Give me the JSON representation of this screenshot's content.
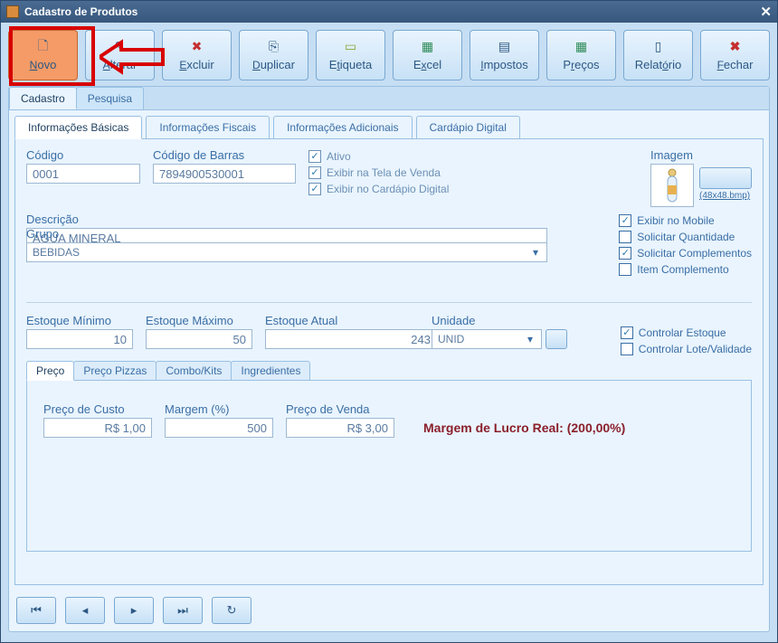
{
  "title": "Cadastro de Produtos",
  "toolbar": {
    "novo": "Novo",
    "alterar": "Alterar",
    "excluir": "Excluir",
    "duplicar": "Duplicar",
    "etiqueta": "Etiqueta",
    "excel": "Excel",
    "impostos": "Impostos",
    "precos": "Preços",
    "relatorio": "Relatório",
    "fechar": "Fechar"
  },
  "outerTabs": {
    "cadastro": "Cadastro",
    "pesquisa": "Pesquisa"
  },
  "innerTabs": {
    "basicas": "Informações Básicas",
    "fiscais": "Informações Fiscais",
    "adicionais": "Informações Adicionais",
    "cardapio": "Cardápio Digital"
  },
  "fields": {
    "codigo_label": "Código",
    "codigo_val": "0001",
    "codbarras_label": "Código de Barras",
    "codbarras_val": "7894900530001",
    "descricao_label": "Descrição",
    "descricao_val": "ÁGUA MINERAL",
    "grupo_label": "Grupo",
    "grupo_val": "BEBIDAS",
    "estoque_min_label": "Estoque Mínimo",
    "estoque_min_val": "10",
    "estoque_max_label": "Estoque Máximo",
    "estoque_max_val": "50",
    "estoque_atual_label": "Estoque Atual",
    "estoque_atual_val": "243",
    "unidade_label": "Unidade",
    "unidade_val": "UNID",
    "imagem_label": "Imagem",
    "imagem_filename": "(48x48.bmp)"
  },
  "checks": {
    "ativo": "Ativo",
    "exibir_tela": "Exibir na Tela de Venda",
    "exibir_cardapio": "Exibir no Cardápio Digital",
    "exibir_mobile": "Exibir no Mobile",
    "solicitar_qtd": "Solicitar Quantidade",
    "solicitar_comp": "Solicitar Complementos",
    "item_comp": "Item Complemento",
    "controlar_estoque": "Controlar Estoque",
    "controlar_lote": "Controlar Lote/Validade"
  },
  "priceTabs": {
    "preco": "Preço",
    "pizzas": "Preço Pizzas",
    "combo": "Combo/Kits",
    "ingredientes": "Ingredientes"
  },
  "price": {
    "custo_label": "Preço de Custo",
    "custo_val": "R$ 1,00",
    "margem_label": "Margem (%)",
    "margem_val": "500",
    "venda_label": "Preço de Venda",
    "venda_val": "R$ 3,00",
    "margem_real": "Margem de Lucro Real: (200,00%)"
  }
}
